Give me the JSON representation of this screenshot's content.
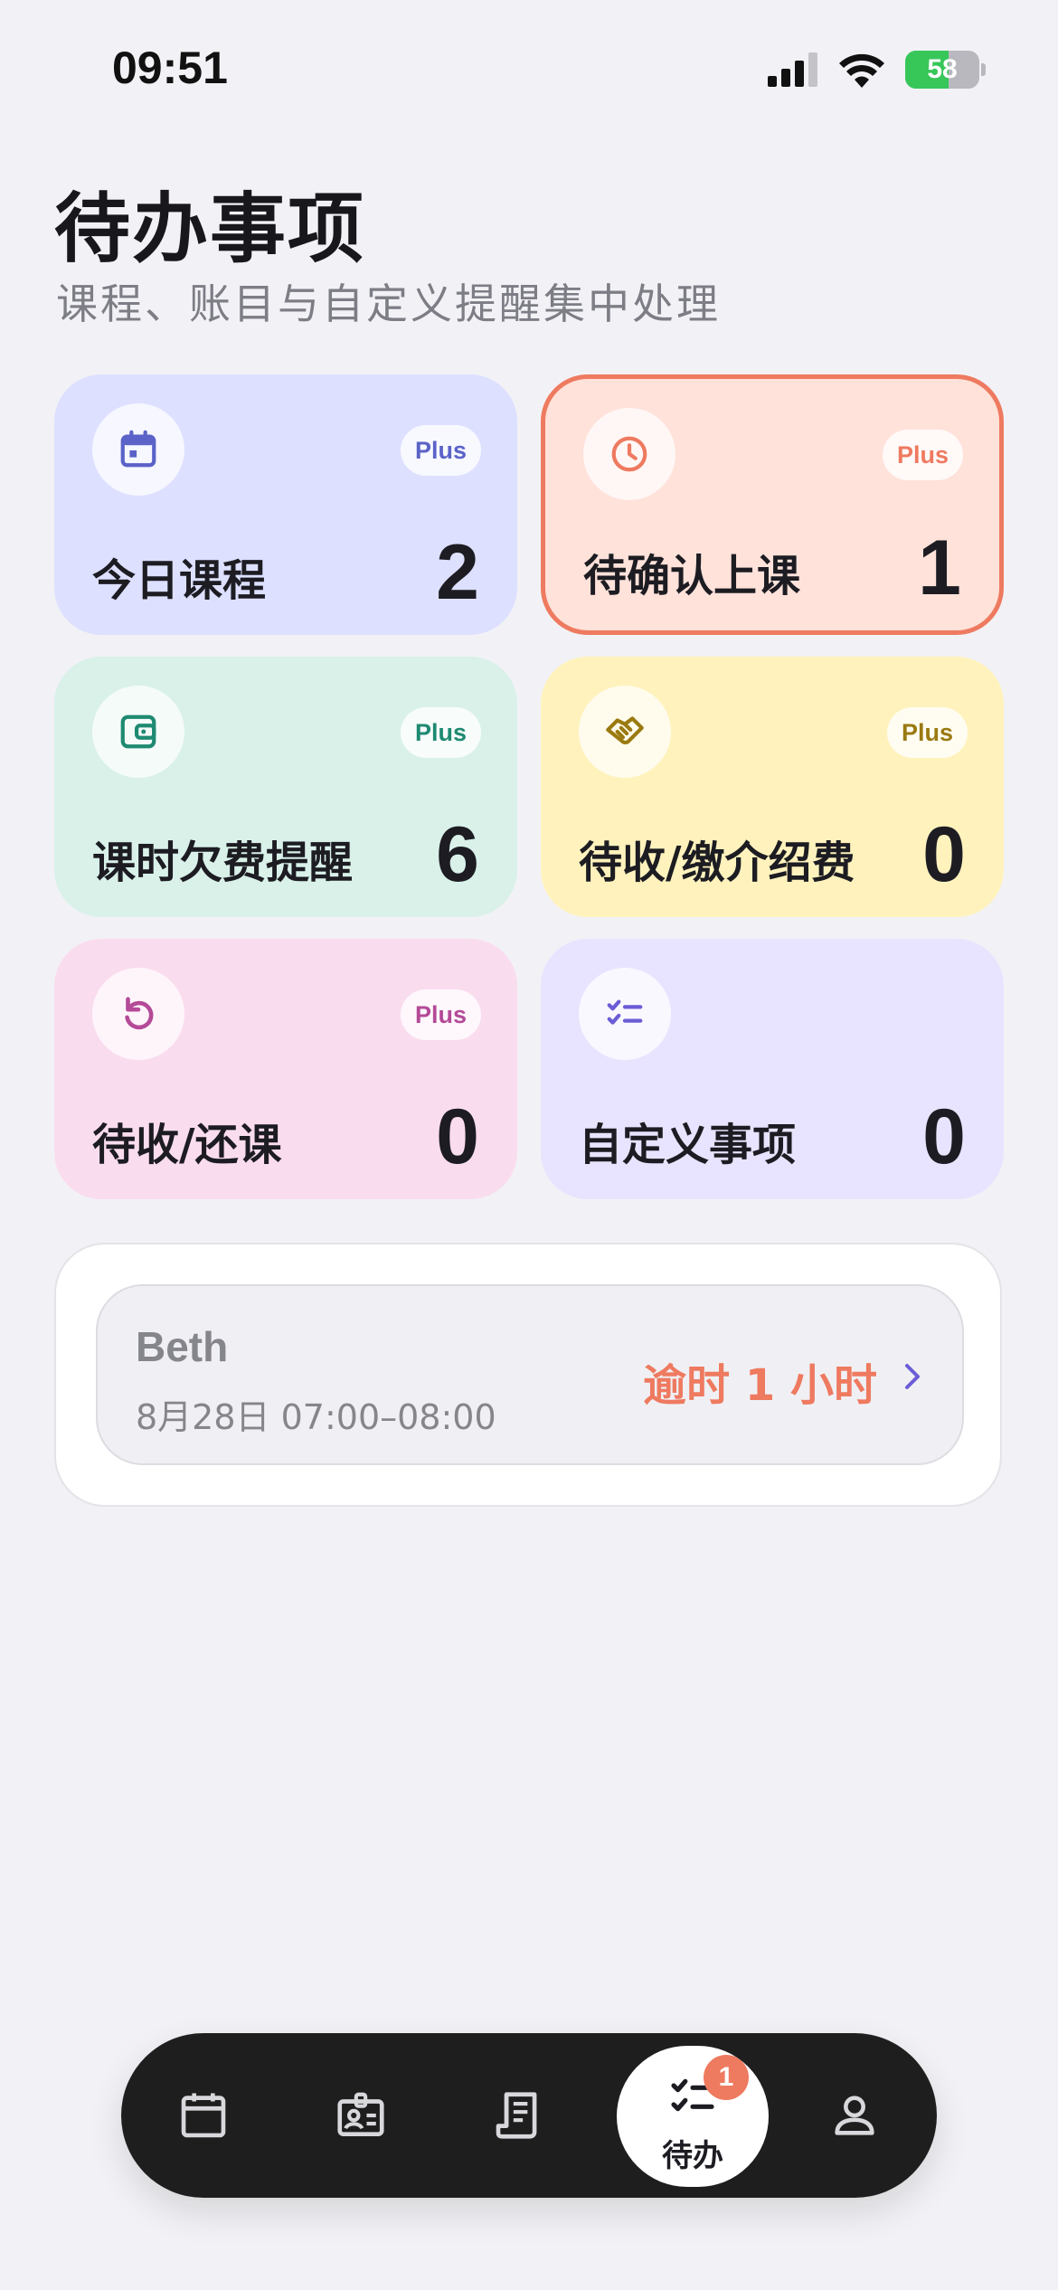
{
  "status_bar": {
    "time": "09:51",
    "battery": "58",
    "battery_level": 0.58
  },
  "header": {
    "title": "待办事项",
    "subtitle": "课程、账目与自定义提醒集中处理"
  },
  "cards": [
    {
      "id": "today-courses",
      "label": "今日课程",
      "count": "2",
      "badge": "Plus",
      "icon": "calendar-icon",
      "bg": "#dde0ff",
      "accent": "#5b63c8"
    },
    {
      "id": "pending-confirm",
      "label": "待确认上课",
      "count": "1",
      "badge": "Plus",
      "icon": "clock-icon",
      "bg": "#ffe2da",
      "accent": "#ee7a60",
      "border": "#ee7a60"
    },
    {
      "id": "fee-reminder",
      "label": "课时欠费提醒",
      "count": "6",
      "badge": "Plus",
      "icon": "wallet-icon",
      "bg": "#d9f1e9",
      "accent": "#1e8a72"
    },
    {
      "id": "referral-fee",
      "label": "待收/缴介绍费",
      "count": "0",
      "badge": "Plus",
      "icon": "handshake-icon",
      "bg": "#fff2bd",
      "accent": "#9a7a10"
    },
    {
      "id": "makeup-lessons",
      "label": "待收/还课",
      "count": "0",
      "badge": "Plus",
      "icon": "undo-icon",
      "bg": "#fadcef",
      "accent": "#b44a98"
    },
    {
      "id": "custom-items",
      "label": "自定义事项",
      "count": "0",
      "badge": "",
      "icon": "checklist-icon",
      "bg": "#e8e4ff",
      "accent": "#6b5dd6"
    }
  ],
  "reminder": {
    "name": "Beth",
    "time": "8月28日 07:00–08:00",
    "status": "逾时 1 小时"
  },
  "bottom_nav": {
    "items": [
      {
        "name": "calendar",
        "icon": "calendar-icon"
      },
      {
        "name": "contacts",
        "icon": "id-card-icon"
      },
      {
        "name": "ledger",
        "icon": "receipt-icon"
      },
      {
        "name": "todo",
        "icon": "checklist-icon",
        "label": "待办",
        "badge": "1",
        "active": true
      },
      {
        "name": "profile",
        "icon": "person-icon"
      }
    ]
  },
  "colors": {
    "background": "#f2f2f6",
    "overdue": "#ee7a60",
    "nav_bg": "#1e1e1e"
  }
}
